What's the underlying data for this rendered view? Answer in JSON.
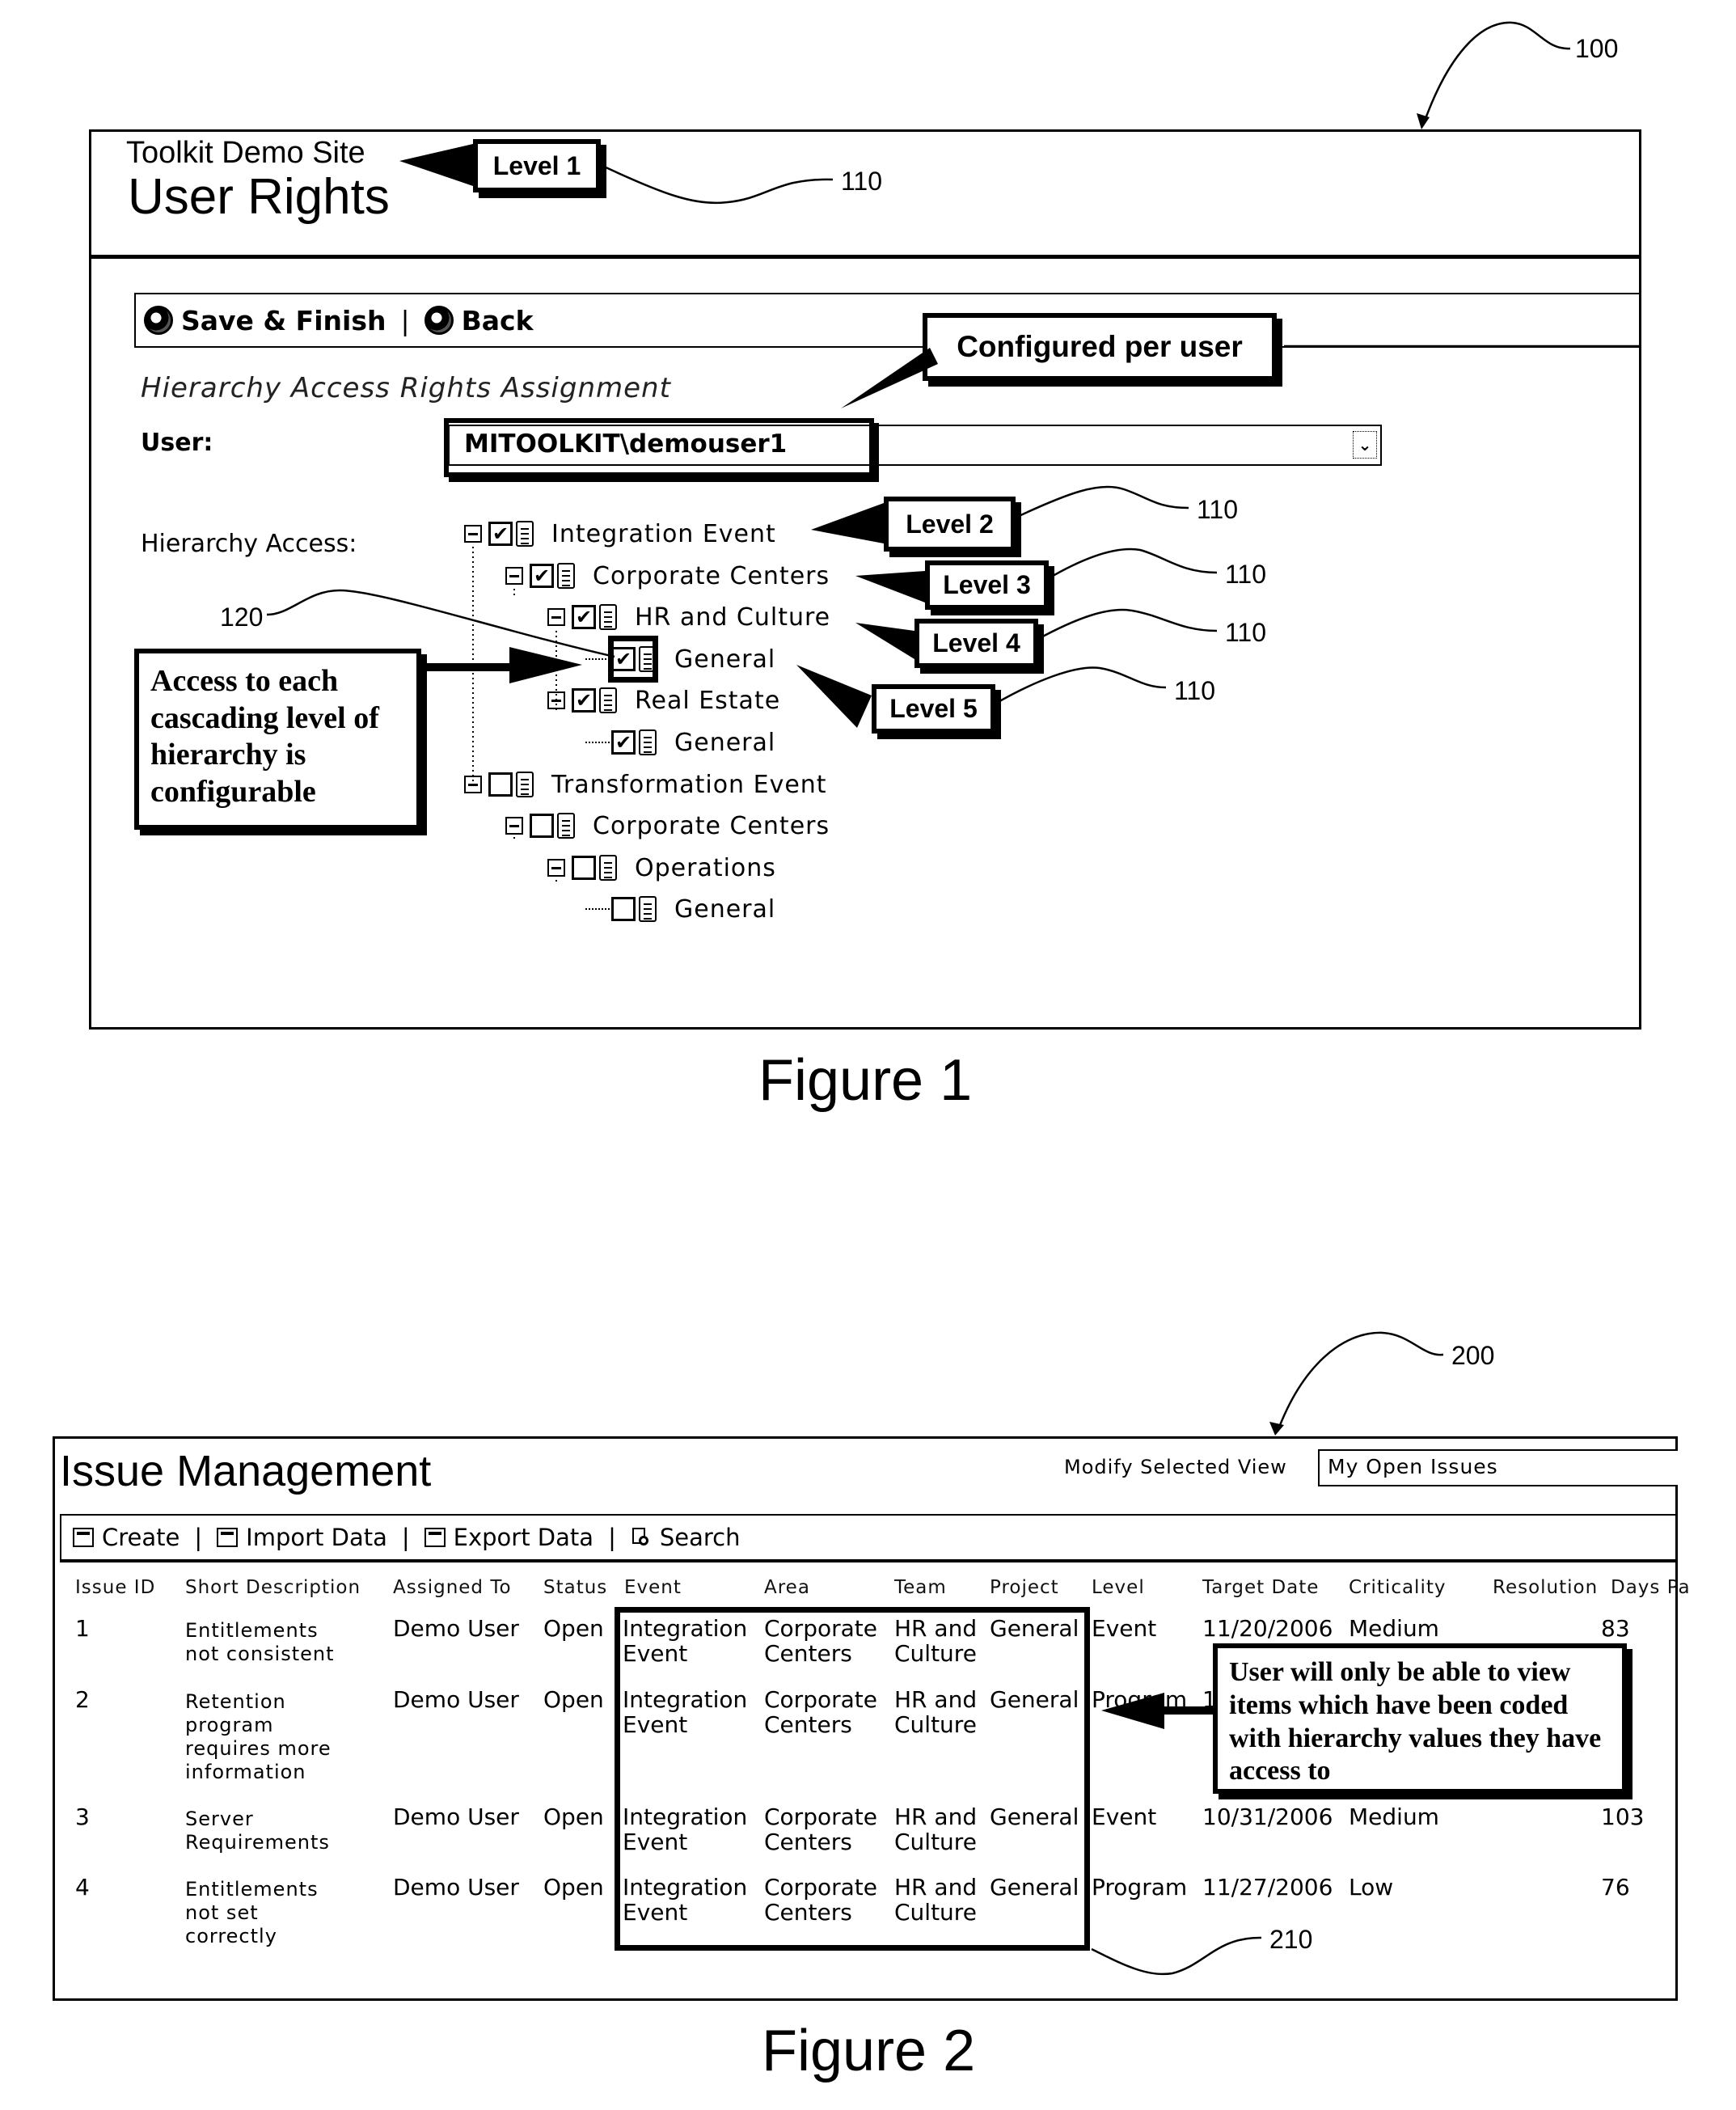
{
  "figure1": {
    "reference_number": "100",
    "caption": "Figure 1",
    "header": {
      "site_name": "Toolkit Demo Site",
      "page_title": "User Rights"
    },
    "toolbar": {
      "save_label": "Save & Finish",
      "separator": "|",
      "back_label": "Back"
    },
    "section_heading": "Hierarchy Access Rights Assignment",
    "user_field": {
      "label": "User:",
      "value": "MITOOLKIT\\demouser1"
    },
    "hierarchy_label": "Hierarchy Access:",
    "tree": [
      {
        "label": "Integration Event",
        "depth": 0,
        "checked": true,
        "expandable": true
      },
      {
        "label": "Corporate Centers",
        "depth": 1,
        "checked": true,
        "expandable": true
      },
      {
        "label": "HR and Culture",
        "depth": 2,
        "checked": true,
        "expandable": true
      },
      {
        "label": "General",
        "depth": 3,
        "checked": true,
        "expandable": false,
        "highlighted": true
      },
      {
        "label": "Real Estate",
        "depth": 2,
        "checked": true,
        "expandable": true
      },
      {
        "label": "General",
        "depth": 3,
        "checked": true,
        "expandable": false
      },
      {
        "label": "Transformation Event",
        "depth": 0,
        "checked": false,
        "expandable": true
      },
      {
        "label": "Corporate Centers",
        "depth": 1,
        "checked": false,
        "expandable": true
      },
      {
        "label": "Operations",
        "depth": 2,
        "checked": false,
        "expandable": true
      },
      {
        "label": "General",
        "depth": 3,
        "checked": false,
        "expandable": false
      }
    ],
    "callouts": {
      "level1": "Level 1",
      "level2": "Level 2",
      "level3": "Level 3",
      "level4": "Level 4",
      "level5": "Level 5",
      "configured": "Configured per user",
      "access": "Access to each cascading level of hierarchy is configurable"
    },
    "ref_labels": {
      "level": "110",
      "checkbox": "120"
    }
  },
  "figure2": {
    "reference_number": "200",
    "caption": "Figure 2",
    "title": "Issue Management",
    "view_selector": {
      "label": "Modify Selected View",
      "value": "My Open Issues"
    },
    "toolbar": [
      {
        "label": "Create",
        "icon": "create-icon"
      },
      {
        "label": "Import Data",
        "icon": "import-icon"
      },
      {
        "label": "Export Data",
        "icon": "export-icon"
      },
      {
        "label": "Search",
        "icon": "search-icon"
      }
    ],
    "toolbar_separator": "|",
    "table": {
      "columns": [
        "Issue ID",
        "Short Description",
        "Assigned To",
        "Status",
        "Event",
        "Area",
        "Team",
        "Project",
        "Level",
        "Target Date",
        "Criticality",
        "Resolution",
        "Days Pa"
      ],
      "rows": [
        {
          "id": "1",
          "description": "Entitlements\nnot consistent",
          "assigned_to": "Demo User",
          "status": "Open",
          "event": "Integration\nEvent",
          "area": "Corporate\nCenters",
          "team": "HR and\nCulture",
          "project": "General",
          "level": "Event",
          "target_date": "11/20/2006",
          "criticality": "Medium",
          "resolution": "",
          "days": "83"
        },
        {
          "id": "2",
          "description": "Retention\nprogram\nrequires more\ninformation",
          "assigned_to": "Demo User",
          "status": "Open",
          "event": "Integration\nEvent",
          "area": "Corporate\nCenters",
          "team": "HR and\nCulture",
          "project": "General",
          "level": "Program",
          "target_date": "1",
          "criticality": "",
          "resolution": "",
          "days": ""
        },
        {
          "id": "3",
          "description": "Server\nRequirements",
          "assigned_to": "Demo User",
          "status": "Open",
          "event": "Integration\nEvent",
          "area": "Corporate\nCenters",
          "team": "HR and\nCulture",
          "project": "General",
          "level": "Event",
          "target_date": "10/31/2006",
          "criticality": "Medium",
          "resolution": "",
          "days": "103"
        },
        {
          "id": "4",
          "description": "Entitlements\nnot set\ncorrectly",
          "assigned_to": "Demo User",
          "status": "Open",
          "event": "Integration\nEvent",
          "area": "Corporate\nCenters",
          "team": "HR and\nCulture",
          "project": "General",
          "level": "Program",
          "target_date": "11/27/2006",
          "criticality": "Low",
          "resolution": "",
          "days": "76"
        }
      ]
    },
    "callout": "User will only be able to view items which have been coded with hierarchy values they have access to",
    "ref_label_highlight": "210"
  }
}
